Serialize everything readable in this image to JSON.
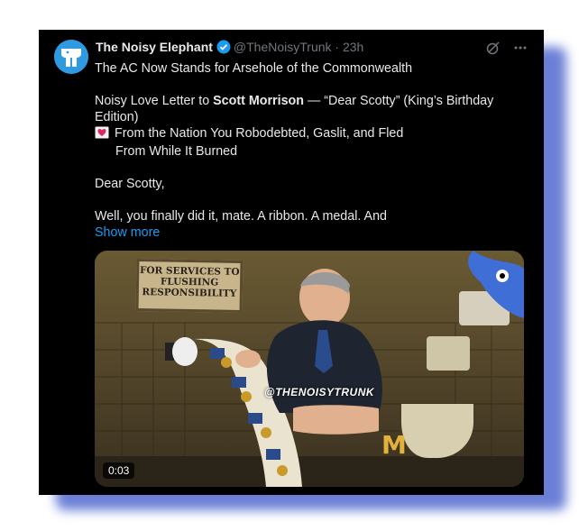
{
  "tweet": {
    "author_name": "The Noisy Elephant",
    "handle": "@TheNoisyTrunk",
    "separator": "·",
    "time": "23h",
    "title_line": "The AC Now Stands for Arsehole of the Commonwealth",
    "intro_prefix": "Noisy Love Letter to ",
    "intro_bold": "Scott Morrison",
    "intro_suffix": " — “Dear Scotty” (King’s Birthday Edition)",
    "from_line_1": "From the Nation You Robodebted, Gaslit, and Fled",
    "from_line_2": "From While It Burned",
    "salutation": "Dear Scotty,",
    "body_preview": "Well, you finally did it, mate. A ribbon. A medal. And",
    "show_more": "Show more"
  },
  "media": {
    "sign_text": "FOR SERVICES TO FLUSHING RESPONSIBILITY",
    "sign_lines": [
      "FOR SERVICES TO",
      "FLUSHING",
      "RESPONSIBILITY"
    ],
    "watermark": "@THENOISYTRUNK",
    "duration": "0:03"
  },
  "icons": {
    "verified": "verified-badge-icon",
    "grok": "grok-icon",
    "more": "more-options-icon",
    "heart": "love-letter-icon"
  },
  "colors": {
    "background": "#000000",
    "text": "#e7e9ea",
    "muted": "#71767b",
    "link": "#1d9bf0",
    "frame_shadow": "#6b7fd6"
  }
}
